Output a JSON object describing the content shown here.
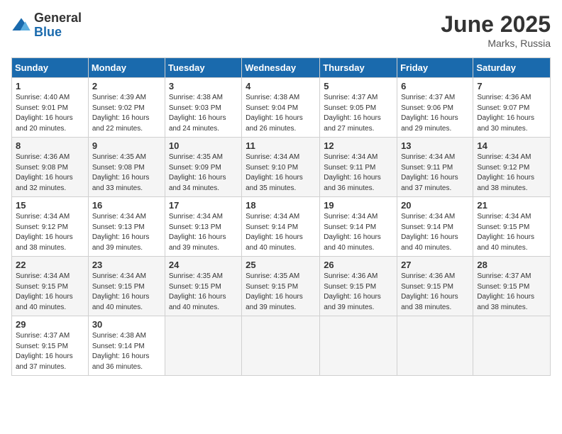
{
  "logo": {
    "general": "General",
    "blue": "Blue"
  },
  "title": {
    "month": "June 2025",
    "location": "Marks, Russia"
  },
  "headers": [
    "Sunday",
    "Monday",
    "Tuesday",
    "Wednesday",
    "Thursday",
    "Friday",
    "Saturday"
  ],
  "weeks": [
    [
      {
        "day": "1",
        "info": "Sunrise: 4:40 AM\nSunset: 9:01 PM\nDaylight: 16 hours\nand 20 minutes."
      },
      {
        "day": "2",
        "info": "Sunrise: 4:39 AM\nSunset: 9:02 PM\nDaylight: 16 hours\nand 22 minutes."
      },
      {
        "day": "3",
        "info": "Sunrise: 4:38 AM\nSunset: 9:03 PM\nDaylight: 16 hours\nand 24 minutes."
      },
      {
        "day": "4",
        "info": "Sunrise: 4:38 AM\nSunset: 9:04 PM\nDaylight: 16 hours\nand 26 minutes."
      },
      {
        "day": "5",
        "info": "Sunrise: 4:37 AM\nSunset: 9:05 PM\nDaylight: 16 hours\nand 27 minutes."
      },
      {
        "day": "6",
        "info": "Sunrise: 4:37 AM\nSunset: 9:06 PM\nDaylight: 16 hours\nand 29 minutes."
      },
      {
        "day": "7",
        "info": "Sunrise: 4:36 AM\nSunset: 9:07 PM\nDaylight: 16 hours\nand 30 minutes."
      }
    ],
    [
      {
        "day": "8",
        "info": "Sunrise: 4:36 AM\nSunset: 9:08 PM\nDaylight: 16 hours\nand 32 minutes."
      },
      {
        "day": "9",
        "info": "Sunrise: 4:35 AM\nSunset: 9:08 PM\nDaylight: 16 hours\nand 33 minutes."
      },
      {
        "day": "10",
        "info": "Sunrise: 4:35 AM\nSunset: 9:09 PM\nDaylight: 16 hours\nand 34 minutes."
      },
      {
        "day": "11",
        "info": "Sunrise: 4:34 AM\nSunset: 9:10 PM\nDaylight: 16 hours\nand 35 minutes."
      },
      {
        "day": "12",
        "info": "Sunrise: 4:34 AM\nSunset: 9:11 PM\nDaylight: 16 hours\nand 36 minutes."
      },
      {
        "day": "13",
        "info": "Sunrise: 4:34 AM\nSunset: 9:11 PM\nDaylight: 16 hours\nand 37 minutes."
      },
      {
        "day": "14",
        "info": "Sunrise: 4:34 AM\nSunset: 9:12 PM\nDaylight: 16 hours\nand 38 minutes."
      }
    ],
    [
      {
        "day": "15",
        "info": "Sunrise: 4:34 AM\nSunset: 9:12 PM\nDaylight: 16 hours\nand 38 minutes."
      },
      {
        "day": "16",
        "info": "Sunrise: 4:34 AM\nSunset: 9:13 PM\nDaylight: 16 hours\nand 39 minutes."
      },
      {
        "day": "17",
        "info": "Sunrise: 4:34 AM\nSunset: 9:13 PM\nDaylight: 16 hours\nand 39 minutes."
      },
      {
        "day": "18",
        "info": "Sunrise: 4:34 AM\nSunset: 9:14 PM\nDaylight: 16 hours\nand 40 minutes."
      },
      {
        "day": "19",
        "info": "Sunrise: 4:34 AM\nSunset: 9:14 PM\nDaylight: 16 hours\nand 40 minutes."
      },
      {
        "day": "20",
        "info": "Sunrise: 4:34 AM\nSunset: 9:14 PM\nDaylight: 16 hours\nand 40 minutes."
      },
      {
        "day": "21",
        "info": "Sunrise: 4:34 AM\nSunset: 9:15 PM\nDaylight: 16 hours\nand 40 minutes."
      }
    ],
    [
      {
        "day": "22",
        "info": "Sunrise: 4:34 AM\nSunset: 9:15 PM\nDaylight: 16 hours\nand 40 minutes."
      },
      {
        "day": "23",
        "info": "Sunrise: 4:34 AM\nSunset: 9:15 PM\nDaylight: 16 hours\nand 40 minutes."
      },
      {
        "day": "24",
        "info": "Sunrise: 4:35 AM\nSunset: 9:15 PM\nDaylight: 16 hours\nand 40 minutes."
      },
      {
        "day": "25",
        "info": "Sunrise: 4:35 AM\nSunset: 9:15 PM\nDaylight: 16 hours\nand 39 minutes."
      },
      {
        "day": "26",
        "info": "Sunrise: 4:36 AM\nSunset: 9:15 PM\nDaylight: 16 hours\nand 39 minutes."
      },
      {
        "day": "27",
        "info": "Sunrise: 4:36 AM\nSunset: 9:15 PM\nDaylight: 16 hours\nand 38 minutes."
      },
      {
        "day": "28",
        "info": "Sunrise: 4:37 AM\nSunset: 9:15 PM\nDaylight: 16 hours\nand 38 minutes."
      }
    ],
    [
      {
        "day": "29",
        "info": "Sunrise: 4:37 AM\nSunset: 9:15 PM\nDaylight: 16 hours\nand 37 minutes."
      },
      {
        "day": "30",
        "info": "Sunrise: 4:38 AM\nSunset: 9:14 PM\nDaylight: 16 hours\nand 36 minutes."
      },
      null,
      null,
      null,
      null,
      null
    ]
  ]
}
